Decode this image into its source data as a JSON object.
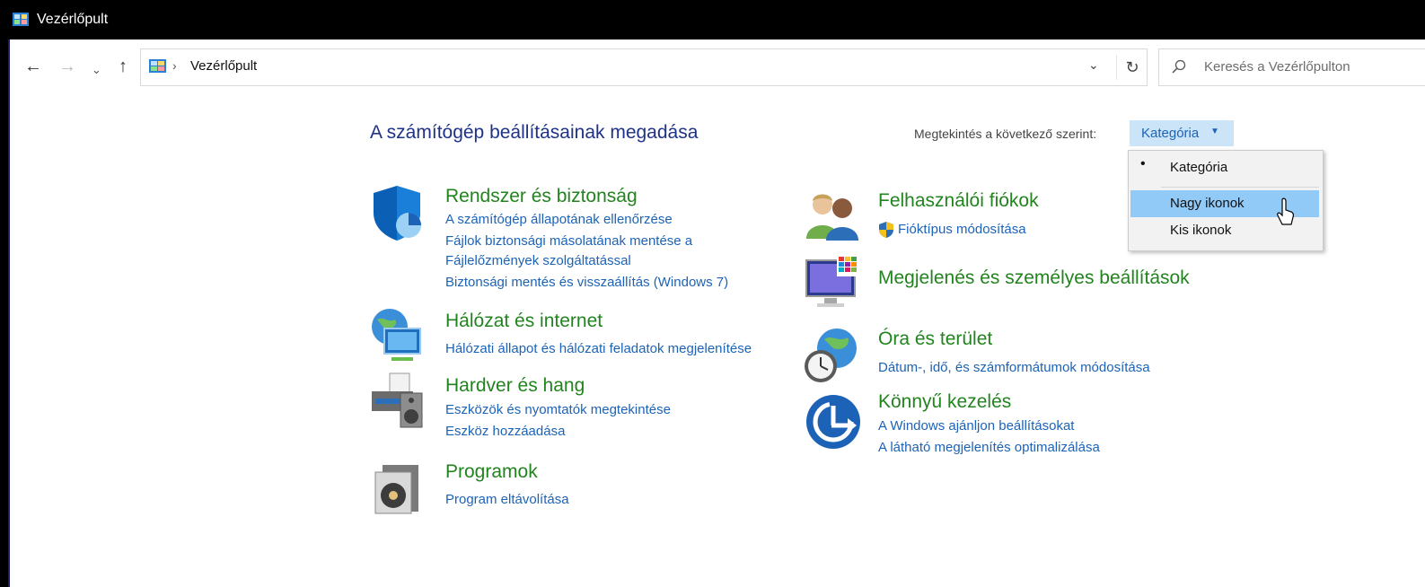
{
  "window": {
    "title": "Vezérlőpult"
  },
  "nav": {
    "back": "←",
    "forward": "→",
    "recent": "⌄",
    "up": "↑",
    "breadcrumb_sep": "›",
    "address": "Vezérlőpult",
    "address_dropdown": "⌄",
    "refresh": "↻",
    "search_placeholder": "Keresés a Vezérlőpulton"
  },
  "main": {
    "title": "A számítógép beállításainak megadása",
    "view_by_label": "Megtekintés a következő szerint:",
    "view_by_value": "Kategória",
    "view_by_arrow": "▼"
  },
  "dropdown": {
    "bullet": "•",
    "items": [
      {
        "label": "Kategória",
        "selected": true
      },
      {
        "label": "Nagy ikonok",
        "hovered": true
      },
      {
        "label": "Kis ikonok"
      }
    ]
  },
  "categories": {
    "system": {
      "icon": "shield-icon",
      "title": "Rendszer és biztonság",
      "links": [
        "A számítógép állapotának ellenőrzése",
        "Fájlok biztonsági másolatának mentése a",
        "Fájlelőzmények szolgáltatással",
        "Biztonsági mentés és visszaállítás (Windows 7)"
      ]
    },
    "network": {
      "icon": "network-globe-icon",
      "title": "Hálózat és internet",
      "links": [
        "Hálózati állapot és hálózati feladatok megjelenítése"
      ]
    },
    "hardware": {
      "icon": "printer-speaker-icon",
      "title": "Hardver és hang",
      "links": [
        "Eszközök és nyomtatók megtekintése",
        "Eszköz hozzáadása"
      ]
    },
    "programs": {
      "icon": "programs-disc-icon",
      "title": "Programok",
      "links": [
        "Program eltávolítása"
      ]
    },
    "accounts": {
      "icon": "users-icon",
      "title": "Felhasználói fiókok",
      "links": [
        "Fióktípus módosítása"
      ]
    },
    "appearance": {
      "icon": "monitor-colors-icon",
      "title": "Megjelenés és személyes beállítások",
      "links": []
    },
    "clock": {
      "icon": "clock-globe-icon",
      "title": "Óra és terület",
      "links": [
        "Dátum-, idő, és számformátumok módosítása"
      ]
    },
    "ease": {
      "icon": "ease-of-access-icon",
      "title": "Könnyű kezelés",
      "links": [
        "A Windows ajánljon beállításokat",
        "A látható megjelenítés optimalizálása"
      ]
    }
  },
  "colors": {
    "title_blue": "#1e3287",
    "category_green": "#22841e",
    "link_blue": "#1c63b7",
    "dropdown_hover": "#91c9f7"
  }
}
